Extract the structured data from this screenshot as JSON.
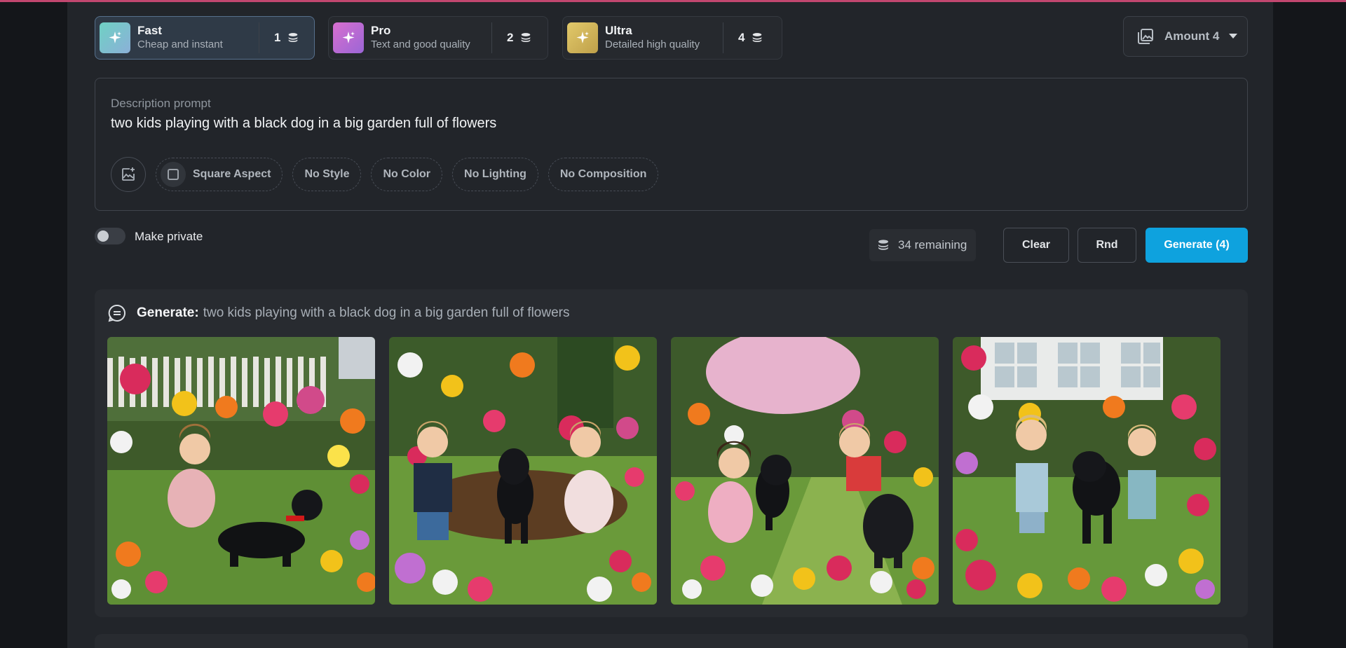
{
  "models": [
    {
      "name": "Fast",
      "desc": "Cheap and instant",
      "cost": "1",
      "color": "#7ac7c0",
      "active": true
    },
    {
      "name": "Pro",
      "desc": "Text and good quality",
      "cost": "2",
      "color": "#c06fd1",
      "active": false
    },
    {
      "name": "Ultra",
      "desc": "Detailed high quality",
      "cost": "4",
      "color": "#d6b85a",
      "active": false
    }
  ],
  "amount": {
    "label": "Amount 4"
  },
  "prompt": {
    "label": "Description prompt",
    "text": "two kids playing with a black dog in a big garden full of flowers"
  },
  "chips": {
    "square": "Square Aspect",
    "style": "No Style",
    "color": "No Color",
    "lighting": "No Lighting",
    "composition": "No Composition"
  },
  "private": {
    "label": "Make private",
    "on": false
  },
  "credits": {
    "remaining": "34 remaining"
  },
  "buttons": {
    "clear": "Clear",
    "rnd": "Rnd",
    "generate": "Generate (4)"
  },
  "result": {
    "prefix": "Generate:",
    "prompt": "two kids playing with a black dog in a big garden full of flowers"
  },
  "icons": [
    "sparkle-icon",
    "coins-icon",
    "images-icon",
    "chevron-down-icon",
    "add-image-icon",
    "checkbox-icon",
    "chat-icon"
  ],
  "colors": {
    "accent": "#0ea2de",
    "topline": "#c2476f"
  }
}
